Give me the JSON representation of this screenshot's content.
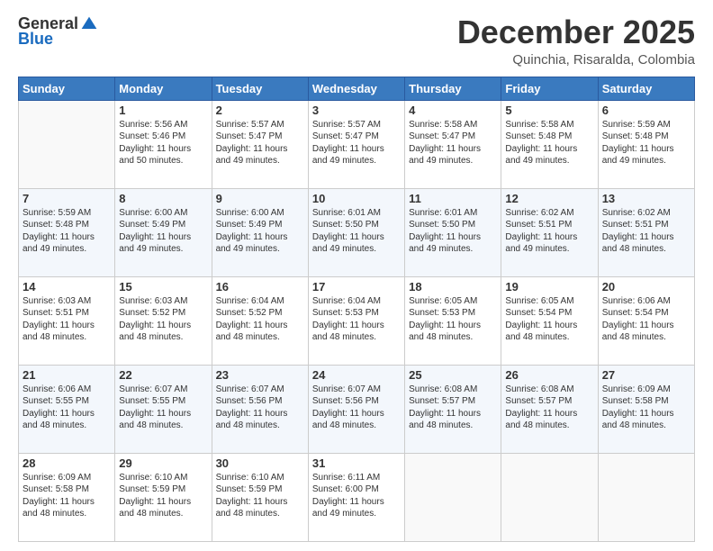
{
  "logo": {
    "general": "General",
    "blue": "Blue"
  },
  "header": {
    "month": "December 2025",
    "location": "Quinchia, Risaralda, Colombia"
  },
  "weekdays": [
    "Sunday",
    "Monday",
    "Tuesday",
    "Wednesday",
    "Thursday",
    "Friday",
    "Saturday"
  ],
  "weeks": [
    [
      {
        "day": "",
        "sunrise": "",
        "sunset": "",
        "daylight": ""
      },
      {
        "day": "1",
        "sunrise": "Sunrise: 5:56 AM",
        "sunset": "Sunset: 5:46 PM",
        "daylight": "Daylight: 11 hours and 50 minutes."
      },
      {
        "day": "2",
        "sunrise": "Sunrise: 5:57 AM",
        "sunset": "Sunset: 5:47 PM",
        "daylight": "Daylight: 11 hours and 49 minutes."
      },
      {
        "day": "3",
        "sunrise": "Sunrise: 5:57 AM",
        "sunset": "Sunset: 5:47 PM",
        "daylight": "Daylight: 11 hours and 49 minutes."
      },
      {
        "day": "4",
        "sunrise": "Sunrise: 5:58 AM",
        "sunset": "Sunset: 5:47 PM",
        "daylight": "Daylight: 11 hours and 49 minutes."
      },
      {
        "day": "5",
        "sunrise": "Sunrise: 5:58 AM",
        "sunset": "Sunset: 5:48 PM",
        "daylight": "Daylight: 11 hours and 49 minutes."
      },
      {
        "day": "6",
        "sunrise": "Sunrise: 5:59 AM",
        "sunset": "Sunset: 5:48 PM",
        "daylight": "Daylight: 11 hours and 49 minutes."
      }
    ],
    [
      {
        "day": "7",
        "sunrise": "Sunrise: 5:59 AM",
        "sunset": "Sunset: 5:48 PM",
        "daylight": "Daylight: 11 hours and 49 minutes."
      },
      {
        "day": "8",
        "sunrise": "Sunrise: 6:00 AM",
        "sunset": "Sunset: 5:49 PM",
        "daylight": "Daylight: 11 hours and 49 minutes."
      },
      {
        "day": "9",
        "sunrise": "Sunrise: 6:00 AM",
        "sunset": "Sunset: 5:49 PM",
        "daylight": "Daylight: 11 hours and 49 minutes."
      },
      {
        "day": "10",
        "sunrise": "Sunrise: 6:01 AM",
        "sunset": "Sunset: 5:50 PM",
        "daylight": "Daylight: 11 hours and 49 minutes."
      },
      {
        "day": "11",
        "sunrise": "Sunrise: 6:01 AM",
        "sunset": "Sunset: 5:50 PM",
        "daylight": "Daylight: 11 hours and 49 minutes."
      },
      {
        "day": "12",
        "sunrise": "Sunrise: 6:02 AM",
        "sunset": "Sunset: 5:51 PM",
        "daylight": "Daylight: 11 hours and 49 minutes."
      },
      {
        "day": "13",
        "sunrise": "Sunrise: 6:02 AM",
        "sunset": "Sunset: 5:51 PM",
        "daylight": "Daylight: 11 hours and 48 minutes."
      }
    ],
    [
      {
        "day": "14",
        "sunrise": "Sunrise: 6:03 AM",
        "sunset": "Sunset: 5:51 PM",
        "daylight": "Daylight: 11 hours and 48 minutes."
      },
      {
        "day": "15",
        "sunrise": "Sunrise: 6:03 AM",
        "sunset": "Sunset: 5:52 PM",
        "daylight": "Daylight: 11 hours and 48 minutes."
      },
      {
        "day": "16",
        "sunrise": "Sunrise: 6:04 AM",
        "sunset": "Sunset: 5:52 PM",
        "daylight": "Daylight: 11 hours and 48 minutes."
      },
      {
        "day": "17",
        "sunrise": "Sunrise: 6:04 AM",
        "sunset": "Sunset: 5:53 PM",
        "daylight": "Daylight: 11 hours and 48 minutes."
      },
      {
        "day": "18",
        "sunrise": "Sunrise: 6:05 AM",
        "sunset": "Sunset: 5:53 PM",
        "daylight": "Daylight: 11 hours and 48 minutes."
      },
      {
        "day": "19",
        "sunrise": "Sunrise: 6:05 AM",
        "sunset": "Sunset: 5:54 PM",
        "daylight": "Daylight: 11 hours and 48 minutes."
      },
      {
        "day": "20",
        "sunrise": "Sunrise: 6:06 AM",
        "sunset": "Sunset: 5:54 PM",
        "daylight": "Daylight: 11 hours and 48 minutes."
      }
    ],
    [
      {
        "day": "21",
        "sunrise": "Sunrise: 6:06 AM",
        "sunset": "Sunset: 5:55 PM",
        "daylight": "Daylight: 11 hours and 48 minutes."
      },
      {
        "day": "22",
        "sunrise": "Sunrise: 6:07 AM",
        "sunset": "Sunset: 5:55 PM",
        "daylight": "Daylight: 11 hours and 48 minutes."
      },
      {
        "day": "23",
        "sunrise": "Sunrise: 6:07 AM",
        "sunset": "Sunset: 5:56 PM",
        "daylight": "Daylight: 11 hours and 48 minutes."
      },
      {
        "day": "24",
        "sunrise": "Sunrise: 6:07 AM",
        "sunset": "Sunset: 5:56 PM",
        "daylight": "Daylight: 11 hours and 48 minutes."
      },
      {
        "day": "25",
        "sunrise": "Sunrise: 6:08 AM",
        "sunset": "Sunset: 5:57 PM",
        "daylight": "Daylight: 11 hours and 48 minutes."
      },
      {
        "day": "26",
        "sunrise": "Sunrise: 6:08 AM",
        "sunset": "Sunset: 5:57 PM",
        "daylight": "Daylight: 11 hours and 48 minutes."
      },
      {
        "day": "27",
        "sunrise": "Sunrise: 6:09 AM",
        "sunset": "Sunset: 5:58 PM",
        "daylight": "Daylight: 11 hours and 48 minutes."
      }
    ],
    [
      {
        "day": "28",
        "sunrise": "Sunrise: 6:09 AM",
        "sunset": "Sunset: 5:58 PM",
        "daylight": "Daylight: 11 hours and 48 minutes."
      },
      {
        "day": "29",
        "sunrise": "Sunrise: 6:10 AM",
        "sunset": "Sunset: 5:59 PM",
        "daylight": "Daylight: 11 hours and 48 minutes."
      },
      {
        "day": "30",
        "sunrise": "Sunrise: 6:10 AM",
        "sunset": "Sunset: 5:59 PM",
        "daylight": "Daylight: 11 hours and 48 minutes."
      },
      {
        "day": "31",
        "sunrise": "Sunrise: 6:11 AM",
        "sunset": "Sunset: 6:00 PM",
        "daylight": "Daylight: 11 hours and 49 minutes."
      },
      {
        "day": "",
        "sunrise": "",
        "sunset": "",
        "daylight": ""
      },
      {
        "day": "",
        "sunrise": "",
        "sunset": "",
        "daylight": ""
      },
      {
        "day": "",
        "sunrise": "",
        "sunset": "",
        "daylight": ""
      }
    ]
  ]
}
